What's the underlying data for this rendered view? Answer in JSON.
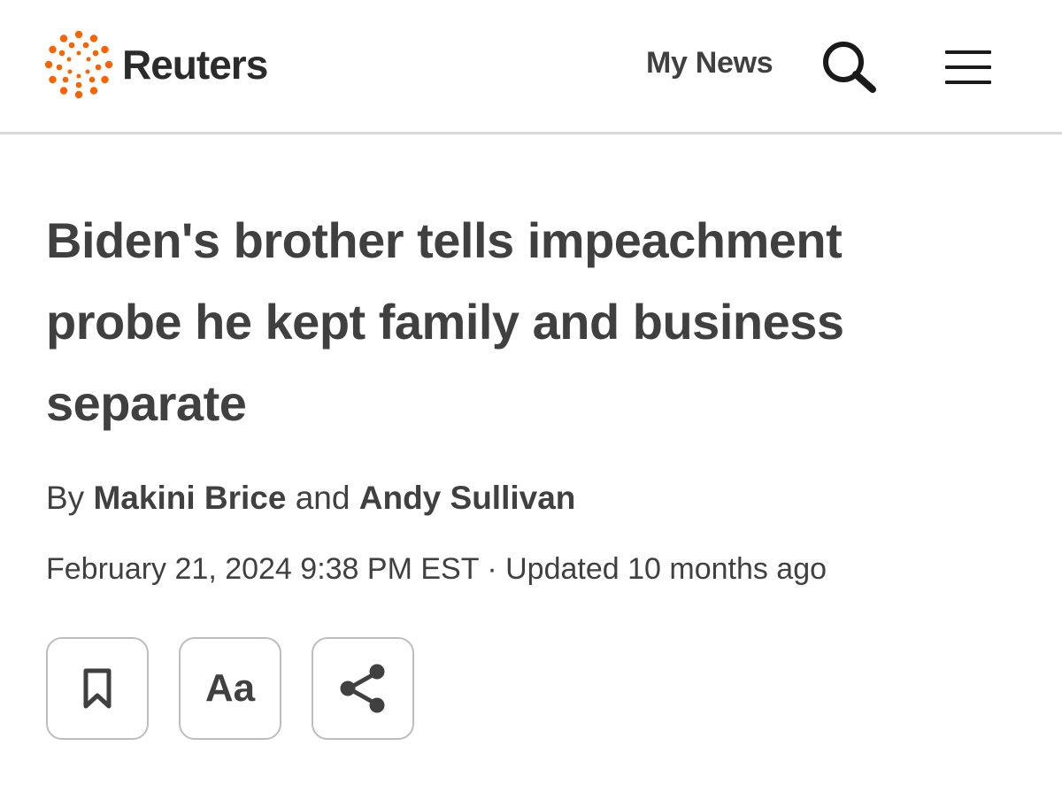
{
  "header": {
    "logo_text": "Reuters",
    "brand_color": "#fa6400",
    "my_news_label": "My News",
    "search_icon": "search-icon",
    "menu_icon": "hamburger-menu-icon"
  },
  "article": {
    "headline": "Biden's brother tells impeachment probe he kept family and business separate",
    "byline": {
      "prefix": "By",
      "author1": "Makini Brice",
      "joiner": "and",
      "author2": "Andy Sullivan"
    },
    "dateline": {
      "published": "February 21, 2024 9:38 PM EST",
      "separator": "·",
      "updated": "Updated 10 months ago"
    }
  },
  "actions": {
    "bookmark_icon": "bookmark-icon",
    "text_size_label": "Aa",
    "share_icon": "share-icon"
  }
}
